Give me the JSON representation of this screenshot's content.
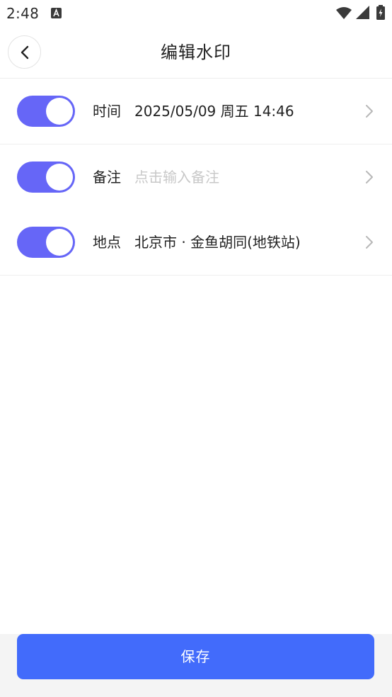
{
  "status_bar": {
    "time": "2:48",
    "icons": [
      "notification-a-icon",
      "wifi-icon",
      "signal-icon",
      "battery-charging-icon"
    ]
  },
  "header": {
    "back_icon": "chevron-left-icon",
    "title": "编辑水印"
  },
  "rows": [
    {
      "label": "时间",
      "value": "2025/05/09 周五 14:46",
      "enabled": true,
      "is_placeholder": false
    },
    {
      "label": "备注",
      "value": "点击输入备注",
      "enabled": true,
      "is_placeholder": true
    },
    {
      "label": "地点",
      "value": "北京市 · 金鱼胡同(地铁站)",
      "enabled": true,
      "is_placeholder": false
    }
  ],
  "footer": {
    "save_label": "保存"
  },
  "colors": {
    "toggle_on": "#6666f7",
    "primary_button": "#426bfb",
    "placeholder_text": "#c8c8c8",
    "divider": "#eeeeee"
  }
}
